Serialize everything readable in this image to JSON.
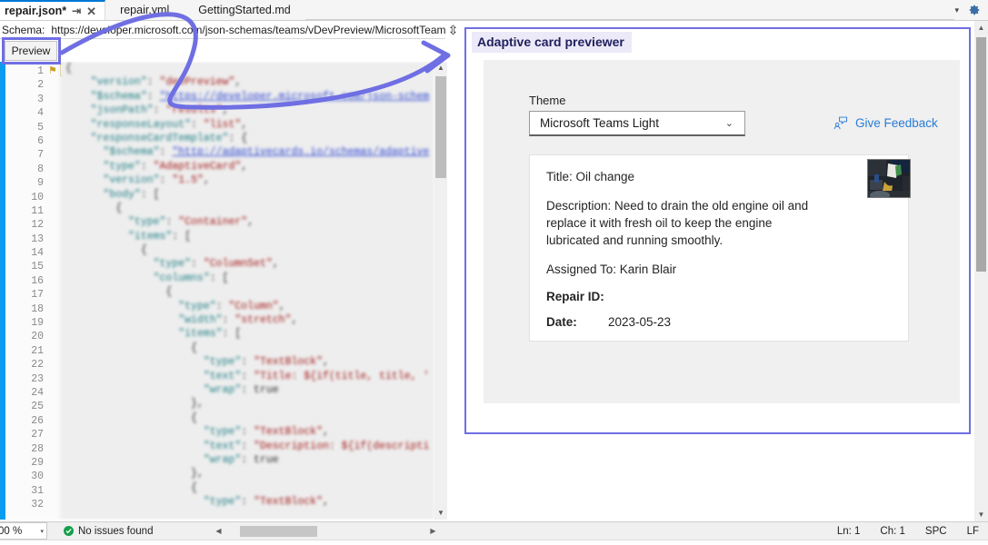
{
  "window": {
    "tabs": [
      {
        "label": "repair.json*",
        "active": true,
        "pin_icon": "pin-icon",
        "close_icon": "close-icon"
      },
      {
        "label": "repair.yml",
        "active": false
      },
      {
        "label": "GettingStarted.md",
        "active": false
      }
    ],
    "tabbar_right": {
      "chevron": "▾",
      "gear_icon": "gear-icon"
    }
  },
  "schema_bar": {
    "label": "Schema:",
    "value": "https://developer.microsoft.com/json-schemas/teams/vDevPreview/MicrosoftTeams.F",
    "dropdown_icon": "▾",
    "split_icon": "split-view-icon"
  },
  "toolbar": {
    "preview_label": "Preview"
  },
  "editor": {
    "first_line": 1,
    "last_line": 32,
    "lines": [
      "{",
      "    \"version\": \"devPreview\",",
      "    \"$schema\": \"https://developer.microsoft.com/json-schem",
      "    \"jsonPath\": \"results\",",
      "    \"responseLayout\": \"list\",",
      "    \"responseCardTemplate\": {",
      "      \"$schema\": \"http://adaptivecards.io/schemas/adaptive",
      "      \"type\": \"AdaptiveCard\",",
      "      \"version\": \"1.5\",",
      "      \"body\": [",
      "        {",
      "          \"type\": \"Container\",",
      "          \"items\": [",
      "            {",
      "              \"type\": \"ColumnSet\",",
      "              \"columns\": [",
      "                {",
      "                  \"type\": \"Column\",",
      "                  \"width\": \"stretch\",",
      "                  \"items\": [",
      "                    {",
      "                      \"type\": \"TextBlock\",",
      "                      \"text\": \"Title: ${if(title, title, '",
      "                      \"wrap\": true",
      "                    },",
      "                    {",
      "                      \"type\": \"TextBlock\",",
      "                      \"text\": \"Description: ${if(descripti",
      "                      \"wrap\": true",
      "                    },",
      "                    {",
      "                      \"type\": \"TextBlock\","
    ],
    "vertical_scrollbar": {
      "up_arrow": "▲",
      "down_arrow": "▼"
    }
  },
  "preview": {
    "title": "Adaptive card previewer",
    "theme": {
      "label": "Theme",
      "selected": "Microsoft Teams Light",
      "chevron_icon": "chevron-down-icon"
    },
    "feedback": {
      "label": "Give Feedback",
      "icon": "feedback-person-icon"
    },
    "card": {
      "title_line": "Title: Oil change",
      "description_line": "Description: Need to drain the old engine oil and replace it with fresh oil to keep the engine lubricated and running smoothly.",
      "assigned_line": "Assigned To: Karin Blair",
      "repair_id_key": "Repair ID:",
      "repair_id_value": "",
      "date_key": "Date:",
      "date_value": "2023-05-23",
      "image_alt": "oil-change-photo"
    }
  },
  "status_bar": {
    "zoom": "00 %",
    "zoom_chevron": "▾",
    "issues_icon": "check-circle-icon",
    "issues": "No issues found",
    "line": "Ln: 1",
    "char": "Ch: 1",
    "spaces": "SPC",
    "eol": "LF",
    "hscroll": {
      "left_arrow": "◀",
      "right_arrow": "▶"
    }
  },
  "colors": {
    "accent_purple": "#6f6fe3",
    "link_blue": "#2a7bd4",
    "tab_active_blue": "#0078d4",
    "ok_green": "#14a04a"
  }
}
